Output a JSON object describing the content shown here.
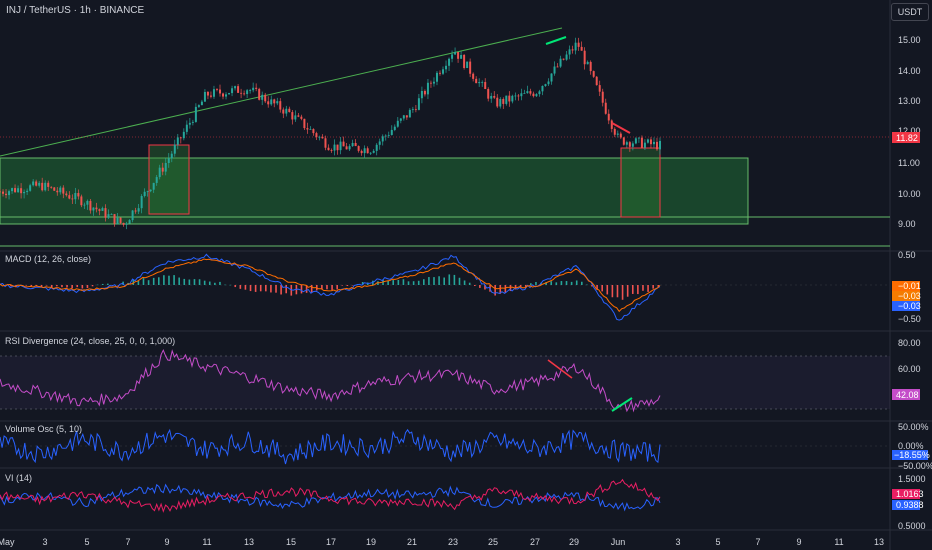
{
  "header": {
    "symbol_title": "INJ / TetherUS · 1h · BINANCE",
    "currency_button": "USDT"
  },
  "panes": [
    {
      "id": "price",
      "label": "",
      "axis_labels": [
        "15.00",
        "14.00",
        "13.00",
        "12.00",
        "11.00",
        "10.00",
        "9.00"
      ],
      "value_badges": [
        {
          "text": "11.82",
          "color": "#f23645"
        }
      ]
    },
    {
      "id": "macd",
      "label": "MACD (12, 26, close)",
      "axis_labels": [
        "0.50",
        "−0.50"
      ],
      "value_badges": [
        {
          "text": "−0.01",
          "color": "#ff6d00"
        },
        {
          "text": "−0.03",
          "color": "#f57c00"
        },
        {
          "text": "−0.03",
          "color": "#2962ff"
        }
      ]
    },
    {
      "id": "rsi",
      "label": "RSI Divergence (24, close, 25, 0, 0, 1,000)",
      "axis_labels": [
        "80.00",
        "60.00"
      ],
      "value_badges": [
        {
          "text": "42.08",
          "color": "#c44dc9"
        }
      ]
    },
    {
      "id": "vol_osc",
      "label": "Volume Osc (5, 10)",
      "axis_labels": [
        "50.00%",
        "0.00%",
        "−50.00%"
      ],
      "value_badges": [
        {
          "text": "−18.55%",
          "color": "#2962ff"
        }
      ]
    },
    {
      "id": "vi",
      "label": "VI (14)",
      "axis_labels": [
        "1.5000",
        "0.5000"
      ],
      "value_badges": [
        {
          "text": "1.0163",
          "color": "#e91e63"
        },
        {
          "text": "0.9388",
          "color": "#2962ff"
        }
      ]
    }
  ],
  "time_axis": [
    "May",
    "3",
    "5",
    "7",
    "9",
    "11",
    "13",
    "15",
    "17",
    "19",
    "21",
    "23",
    "25",
    "27",
    "29",
    "Jun",
    "3",
    "5",
    "7",
    "9",
    "11",
    "13"
  ],
  "colors": {
    "background": "#131722",
    "up_candle": "#26a69a",
    "down_candle": "#ef5350",
    "trend_line": "#4caf50",
    "zone_fill": "#1b4d2e",
    "zone_border": "#66bb6a",
    "box_border": "#f23645",
    "macd_line": "#2962ff",
    "signal_line": "#ff6d00",
    "rsi_line": "#c44dc9",
    "vol_osc_line": "#2962ff",
    "vi_plus": "#2962ff",
    "vi_minus": "#e91e63"
  },
  "chart_data": [
    {
      "type": "line",
      "title": "INJ / TetherUS · 1h · BINANCE",
      "x": [
        "May 1",
        "May 3",
        "May 5",
        "May 7",
        "May 9",
        "May 11",
        "May 13",
        "May 15",
        "May 17",
        "May 19",
        "May 21",
        "May 23",
        "May 25",
        "May 27",
        "May 29",
        "Jun 1",
        "Jun 2"
      ],
      "series": [
        {
          "values": [
            10.3,
            10.5,
            10.0,
            9.2,
            11.2,
            13.5,
            13.7,
            12.9,
            11.8,
            11.7,
            13.0,
            15.0,
            13.2,
            13.6,
            15.2,
            12.0,
            11.82
          ]
        }
      ],
      "ylim": [
        8.5,
        15.7
      ]
    },
    {
      "type": "line",
      "title": "MACD (12, 26, close)",
      "x": [
        "May 1",
        "May 3",
        "May 5",
        "May 7",
        "May 9",
        "May 11",
        "May 13",
        "May 15",
        "May 17",
        "May 19",
        "May 21",
        "May 23",
        "May 25",
        "May 27",
        "May 29",
        "Jun 1",
        "Jun 2"
      ],
      "series": [
        {
          "values": [
            0.0,
            -0.05,
            -0.1,
            0.0,
            0.35,
            0.45,
            0.25,
            -0.05,
            -0.15,
            0.05,
            0.2,
            0.45,
            -0.15,
            0.0,
            0.3,
            -0.55,
            -0.03
          ]
        },
        {
          "values": [
            0.0,
            -0.03,
            -0.08,
            -0.02,
            0.25,
            0.4,
            0.3,
            0.05,
            -0.1,
            0.0,
            0.15,
            0.35,
            -0.05,
            -0.02,
            0.25,
            -0.4,
            -0.01
          ]
        }
      ],
      "ylim": [
        -0.7,
        0.7
      ]
    },
    {
      "type": "line",
      "title": "RSI Divergence (24, close, 25, 0, 0, 1,000)",
      "x": [
        "May 1",
        "May 3",
        "May 5",
        "May 7",
        "May 9",
        "May 11",
        "May 13",
        "May 15",
        "May 17",
        "May 19",
        "May 21",
        "May 23",
        "May 25",
        "May 27",
        "May 29",
        "Jun 1",
        "Jun 2"
      ],
      "series": [
        {
          "values": [
            55,
            48,
            40,
            45,
            78,
            68,
            60,
            50,
            45,
            55,
            60,
            62,
            50,
            56,
            68,
            35,
            42.08
          ]
        }
      ],
      "ylim": [
        30,
        90
      ]
    },
    {
      "type": "line",
      "title": "Volume Osc (5, 10)",
      "x": [
        "May 1",
        "May 3",
        "May 5",
        "May 7",
        "May 9",
        "May 11",
        "May 13",
        "May 15",
        "May 17",
        "May 19",
        "May 21",
        "May 23",
        "May 25",
        "May 27",
        "May 29",
        "Jun 1",
        "Jun 2"
      ],
      "series": [
        {
          "values": [
            5,
            -20,
            20,
            -15,
            30,
            -10,
            15,
            -25,
            10,
            -5,
            25,
            -20,
            15,
            -10,
            20,
            -15,
            -18.55
          ]
        }
      ],
      "ylim": [
        -60,
        60
      ]
    },
    {
      "type": "line",
      "title": "VI (14)",
      "x": [
        "May 1",
        "May 3",
        "May 5",
        "May 7",
        "May 9",
        "May 11",
        "May 13",
        "May 15",
        "May 17",
        "May 19",
        "May 21",
        "May 23",
        "May 25",
        "May 27",
        "May 29",
        "Jun 1",
        "Jun 2"
      ],
      "series": [
        {
          "values": [
            0.95,
            1.05,
            0.9,
            1.1,
            1.2,
            1.05,
            0.95,
            0.85,
            1.0,
            1.1,
            1.05,
            1.15,
            0.85,
            1.0,
            1.05,
            0.8,
            0.9388
          ]
        },
        {
          "values": [
            1.05,
            0.95,
            1.1,
            0.9,
            0.8,
            0.95,
            1.05,
            1.15,
            1.0,
            0.9,
            0.95,
            0.85,
            1.15,
            1.0,
            0.95,
            1.35,
            1.0163
          ]
        }
      ],
      "ylim": [
        0.4,
        1.6
      ]
    }
  ]
}
